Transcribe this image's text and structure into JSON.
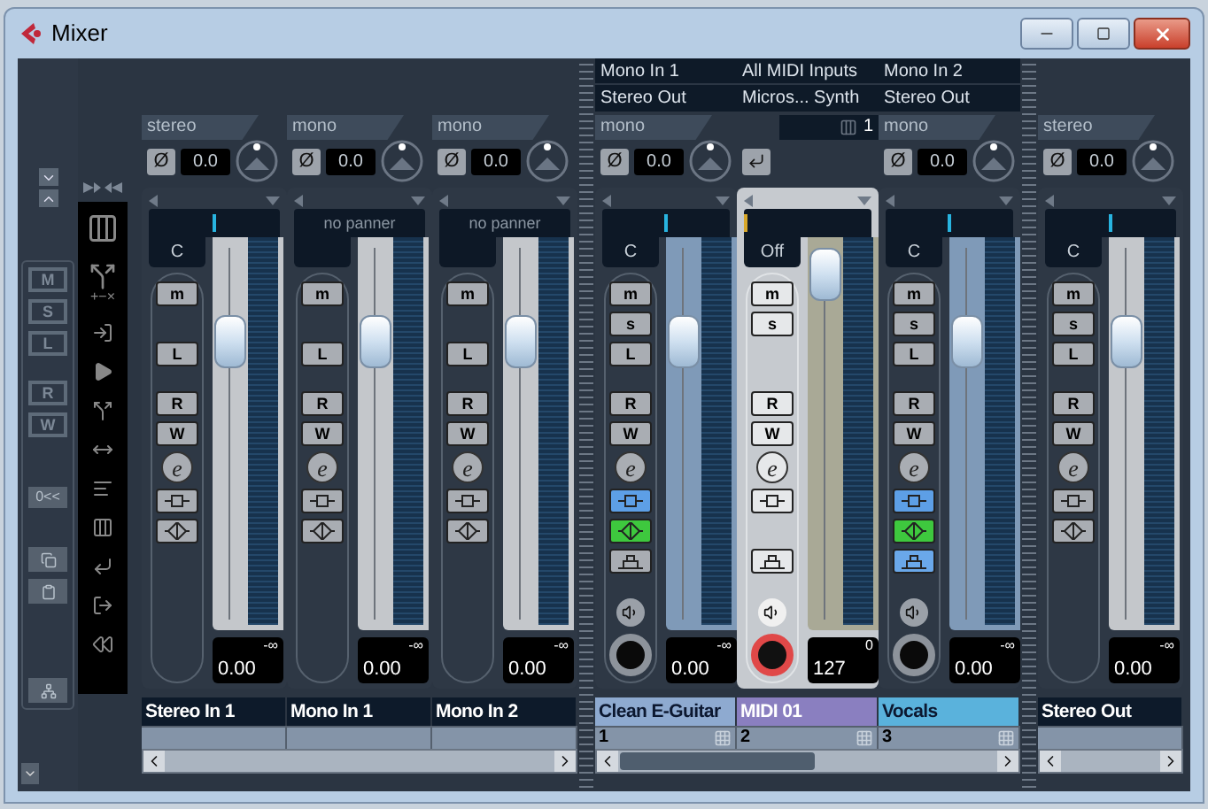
{
  "window": {
    "title": "Mixer"
  },
  "left_panel": {
    "view_buttons": [
      "M",
      "S",
      "L"
    ],
    "automation_buttons": [
      "R",
      "W"
    ],
    "reset_button": "0<<",
    "tool_symbols": "+−×"
  },
  "inputs": [
    {
      "kind": "input",
      "name": "Stereo In 1",
      "color": "#0d1a2a",
      "format": "stereo",
      "phase": "Ø",
      "gain": "0.0",
      "panner": {
        "text": "C",
        "level": 0.5
      },
      "buttons": [
        {
          "kind": "mute",
          "label": "m"
        },
        {
          "kind": "listen",
          "label": "L"
        },
        {
          "kind": "read",
          "label": "R"
        },
        {
          "kind": "write",
          "label": "W"
        },
        {
          "kind": "edit",
          "label": "e"
        }
      ],
      "toggles": [
        {
          "kind": "insert",
          "on": false
        },
        {
          "kind": "eq",
          "on": false
        }
      ],
      "fader": {
        "level": 0.77,
        "value": "0.00",
        "peak": "-∞"
      },
      "selected": false
    },
    {
      "kind": "input",
      "name": "Mono In 1",
      "color": "#0d1a2a",
      "format": "mono",
      "phase": "Ø",
      "gain": "0.0",
      "panner": {
        "text": "no panner"
      },
      "buttons": [
        {
          "kind": "mute",
          "label": "m"
        },
        {
          "kind": "listen",
          "label": "L"
        },
        {
          "kind": "read",
          "label": "R"
        },
        {
          "kind": "write",
          "label": "W"
        },
        {
          "kind": "edit",
          "label": "e"
        }
      ],
      "toggles": [
        {
          "kind": "insert",
          "on": false
        },
        {
          "kind": "eq",
          "on": false
        }
      ],
      "fader": {
        "level": 0.77,
        "value": "0.00",
        "peak": "-∞"
      },
      "selected": false
    },
    {
      "kind": "input",
      "name": "Mono In 2",
      "color": "#0d1a2a",
      "format": "mono",
      "phase": "Ø",
      "gain": "0.0",
      "panner": {
        "text": "no panner"
      },
      "buttons": [
        {
          "kind": "mute",
          "label": "m"
        },
        {
          "kind": "listen",
          "label": "L"
        },
        {
          "kind": "read",
          "label": "R"
        },
        {
          "kind": "write",
          "label": "W"
        },
        {
          "kind": "edit",
          "label": "e"
        }
      ],
      "toggles": [
        {
          "kind": "insert",
          "on": false
        },
        {
          "kind": "eq",
          "on": false
        }
      ],
      "fader": {
        "level": 0.77,
        "value": "0.00",
        "peak": "-∞"
      },
      "selected": false
    }
  ],
  "tracks": [
    {
      "kind": "audio",
      "name": "Clean E-Guitar",
      "color": "#8eaad0",
      "number": "1",
      "io": {
        "input": "Mono In 1",
        "output": "Stereo Out"
      },
      "format": "mono",
      "phase": "Ø",
      "gain": "0.0",
      "panner": {
        "text": "C",
        "level": 0.5
      },
      "buttons": [
        {
          "kind": "mute",
          "label": "m"
        },
        {
          "kind": "solo",
          "label": "s"
        },
        {
          "kind": "listen",
          "label": "L"
        },
        {
          "kind": "read",
          "label": "R"
        },
        {
          "kind": "write",
          "label": "W"
        },
        {
          "kind": "edit",
          "label": "e"
        }
      ],
      "toggles": [
        {
          "kind": "insert",
          "on": true
        },
        {
          "kind": "eq",
          "on": true
        },
        {
          "kind": "send",
          "on": false
        }
      ],
      "record_armed": false,
      "fader": {
        "level": 0.77,
        "value": "0.00",
        "peak": "-∞"
      },
      "selected": false
    },
    {
      "kind": "midi",
      "name": "MIDI 01",
      "color": "#8a7fc0",
      "number": "2",
      "io": {
        "input": "All MIDI Inputs",
        "output": "Micros... Synth"
      },
      "midi_channel": "1",
      "panner": {
        "text": "Off",
        "level": 0
      },
      "buttons": [
        {
          "kind": "mute",
          "label": "m"
        },
        {
          "kind": "solo",
          "label": "s"
        },
        {
          "kind": "read",
          "label": "R"
        },
        {
          "kind": "write",
          "label": "W"
        },
        {
          "kind": "edit",
          "label": "e"
        }
      ],
      "toggles": [
        {
          "kind": "insert",
          "on": false
        },
        {
          "kind": "send",
          "on": false
        }
      ],
      "record_armed": true,
      "fader": {
        "level": 0.97,
        "value": "127",
        "peak": "0"
      },
      "selected": true
    },
    {
      "kind": "audio",
      "name": "Vocals",
      "color": "#5ab2dc",
      "number": "3",
      "io": {
        "input": "Mono In 2",
        "output": "Stereo Out"
      },
      "format": "mono",
      "phase": "Ø",
      "gain": "0.0",
      "panner": {
        "text": "C",
        "level": 0.5
      },
      "buttons": [
        {
          "kind": "mute",
          "label": "m"
        },
        {
          "kind": "solo",
          "label": "s"
        },
        {
          "kind": "listen",
          "label": "L"
        },
        {
          "kind": "read",
          "label": "R"
        },
        {
          "kind": "write",
          "label": "W"
        },
        {
          "kind": "edit",
          "label": "e"
        }
      ],
      "toggles": [
        {
          "kind": "insert",
          "on": true
        },
        {
          "kind": "eq",
          "on": true
        },
        {
          "kind": "send",
          "on": true
        }
      ],
      "record_armed": false,
      "fader": {
        "level": 0.77,
        "value": "0.00",
        "peak": "-∞"
      },
      "selected": false
    }
  ],
  "outputs": [
    {
      "kind": "output",
      "name": "Stereo Out",
      "color": "#0d1a2a",
      "format": "stereo",
      "phase": "Ø",
      "gain": "0.0",
      "panner": {
        "text": "C",
        "level": 0.5
      },
      "buttons": [
        {
          "kind": "mute",
          "label": "m"
        },
        {
          "kind": "solo",
          "label": "s"
        },
        {
          "kind": "listen",
          "label": "L"
        },
        {
          "kind": "read",
          "label": "R"
        },
        {
          "kind": "write",
          "label": "W"
        },
        {
          "kind": "edit",
          "label": "e"
        }
      ],
      "toggles": [
        {
          "kind": "insert",
          "on": false
        },
        {
          "kind": "eq",
          "on": false
        }
      ],
      "fader": {
        "level": 0.77,
        "value": "0.00",
        "peak": "-∞"
      },
      "selected": false
    }
  ]
}
